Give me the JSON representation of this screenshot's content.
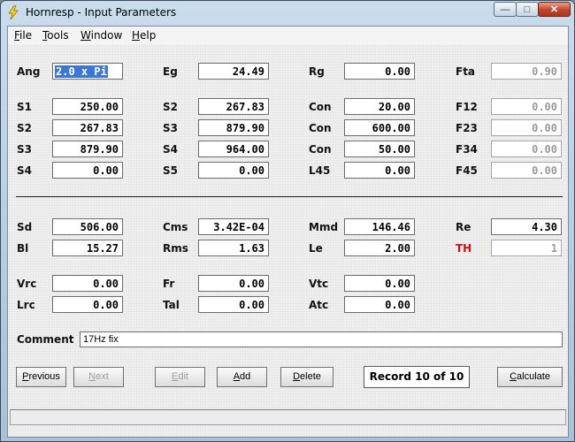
{
  "window": {
    "title": "Hornresp - Input Parameters"
  },
  "menu": [
    {
      "key": "F",
      "rest": "ile"
    },
    {
      "key": "T",
      "rest": "ools"
    },
    {
      "key": "W",
      "rest": "indow"
    },
    {
      "key": "H",
      "rest": "elp"
    }
  ],
  "params": {
    "Ang": {
      "label": "Ang",
      "value": "2.0 x Pi"
    },
    "Eg": {
      "label": "Eg",
      "value": "24.49"
    },
    "Rg": {
      "label": "Rg",
      "value": "0.00"
    },
    "Fta": {
      "label": "Fta",
      "value": "0.90"
    },
    "S1": {
      "label": "S1",
      "value": "250.00"
    },
    "S2a": {
      "label": "S2",
      "value": "267.83"
    },
    "Con1": {
      "label": "Con",
      "value": "20.00"
    },
    "F12": {
      "label": "F12",
      "value": "0.00"
    },
    "S2b": {
      "label": "S2",
      "value": "267.83"
    },
    "S3a": {
      "label": "S3",
      "value": "879.90"
    },
    "Con2": {
      "label": "Con",
      "value": "600.00"
    },
    "F23": {
      "label": "F23",
      "value": "0.00"
    },
    "S3b": {
      "label": "S3",
      "value": "879.90"
    },
    "S4a": {
      "label": "S4",
      "value": "964.00"
    },
    "Con3": {
      "label": "Con",
      "value": "50.00"
    },
    "F34": {
      "label": "F34",
      "value": "0.00"
    },
    "S4b": {
      "label": "S4",
      "value": "0.00"
    },
    "S5": {
      "label": "S5",
      "value": "0.00"
    },
    "L45": {
      "label": "L45",
      "value": "0.00"
    },
    "F45": {
      "label": "F45",
      "value": "0.00"
    },
    "Sd": {
      "label": "Sd",
      "value": "506.00"
    },
    "Cms": {
      "label": "Cms",
      "value": "3.42E-04"
    },
    "Mmd": {
      "label": "Mmd",
      "value": "146.46"
    },
    "Re": {
      "label": "Re",
      "value": "4.30"
    },
    "Bl": {
      "label": "Bl",
      "value": "15.27"
    },
    "Rms": {
      "label": "Rms",
      "value": "1.63"
    },
    "Le": {
      "label": "Le",
      "value": "2.00"
    },
    "TH": {
      "label": "TH",
      "value": "1"
    },
    "Vrc": {
      "label": "Vrc",
      "value": "0.00"
    },
    "Fr": {
      "label": "Fr",
      "value": "0.00"
    },
    "Vtc": {
      "label": "Vtc",
      "value": "0.00"
    },
    "Lrc": {
      "label": "Lrc",
      "value": "0.00"
    },
    "Tal": {
      "label": "Tal",
      "value": "0.00"
    },
    "Atc": {
      "label": "Atc",
      "value": "0.00"
    }
  },
  "comment": {
    "label": "Comment",
    "value": "17Hz fix"
  },
  "buttons": {
    "previous": {
      "key": "P",
      "rest": "revious"
    },
    "next": {
      "key": "N",
      "rest": "ext"
    },
    "edit": {
      "key": "E",
      "rest": "dit"
    },
    "add": {
      "key": "A",
      "rest": "dd"
    },
    "delete": {
      "key": "D",
      "rest": "elete"
    },
    "calculate": {
      "key": "C",
      "rest": "alculate"
    }
  },
  "record": "Record 10 of 10",
  "colors": {
    "selection": "#3a77d6",
    "th_label": "#d01010"
  }
}
